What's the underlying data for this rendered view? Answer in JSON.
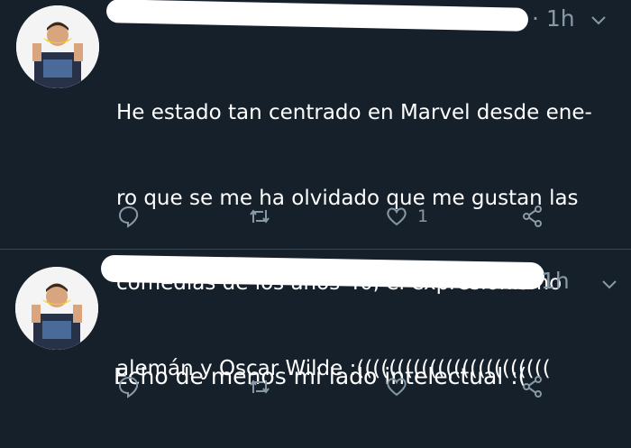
{
  "tweets": [
    {
      "time": "· 1h",
      "lines": [
        "He estado tan centrado en Marvel desde ene-",
        "ro que se me ha olvidado que me gustan las",
        "comedias de los años 40, el expresionismo",
        "alemán y Oscar Wilde :(((((((((((((((((((((((("
      ],
      "like_count": "1"
    },
    {
      "time": "1h",
      "lines": [
        "Echo de menos mi lado intelectual :("
      ],
      "like_count": ""
    }
  ],
  "icons": {
    "reply": "reply-icon",
    "retweet": "retweet-icon",
    "like": "heart-icon",
    "share": "share-icon",
    "menu": "chevron-down-icon"
  },
  "colors": {
    "background": "#15202b",
    "secondary_text": "#8899a6",
    "divider": "#38444d"
  }
}
